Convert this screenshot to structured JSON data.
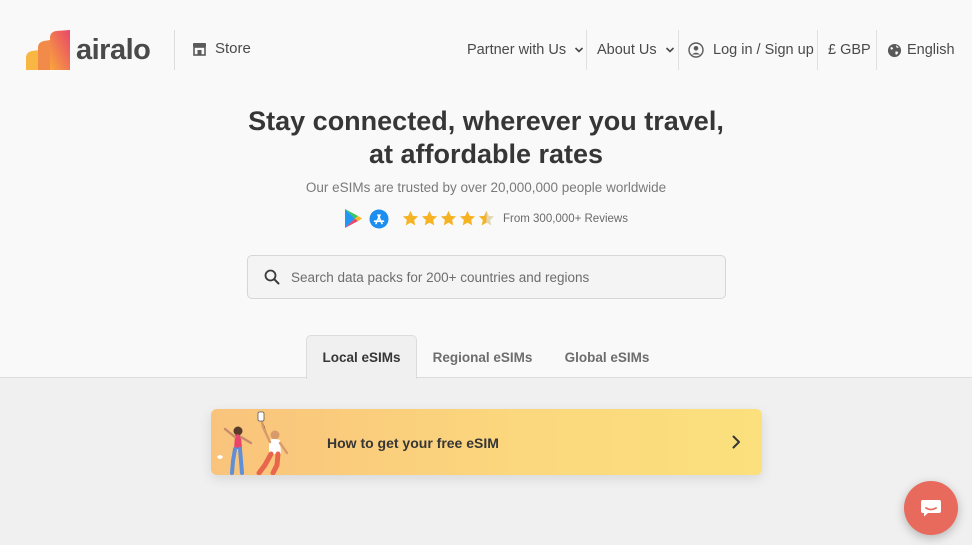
{
  "brand": {
    "name": "airalo"
  },
  "header": {
    "store_label": "Store",
    "partner_label": "Partner with Us",
    "about_label": "About Us",
    "login_label": "Log in / Sign up",
    "currency_label": "£ GBP",
    "language_label": "English"
  },
  "hero": {
    "title_line1": "Stay connected, wherever you travel,",
    "title_line2": "at affordable rates",
    "subtitle": "Our eSIMs are trusted by over 20,000,000 people worldwide",
    "rating_stars": 4.5,
    "reviews_text": "From 300,000+ Reviews"
  },
  "search": {
    "placeholder": "Search data packs for 200+ countries and regions"
  },
  "tabs": [
    {
      "label": "Local eSIMs",
      "active": true
    },
    {
      "label": "Regional eSIMs",
      "active": false
    },
    {
      "label": "Global eSIMs",
      "active": false
    }
  ],
  "banner": {
    "text": "How to get your free eSIM"
  },
  "colors": {
    "accent": "#e86a5d",
    "star": "#f5b324",
    "banner_start": "#f9c37c",
    "banner_end": "#fbe07d"
  }
}
